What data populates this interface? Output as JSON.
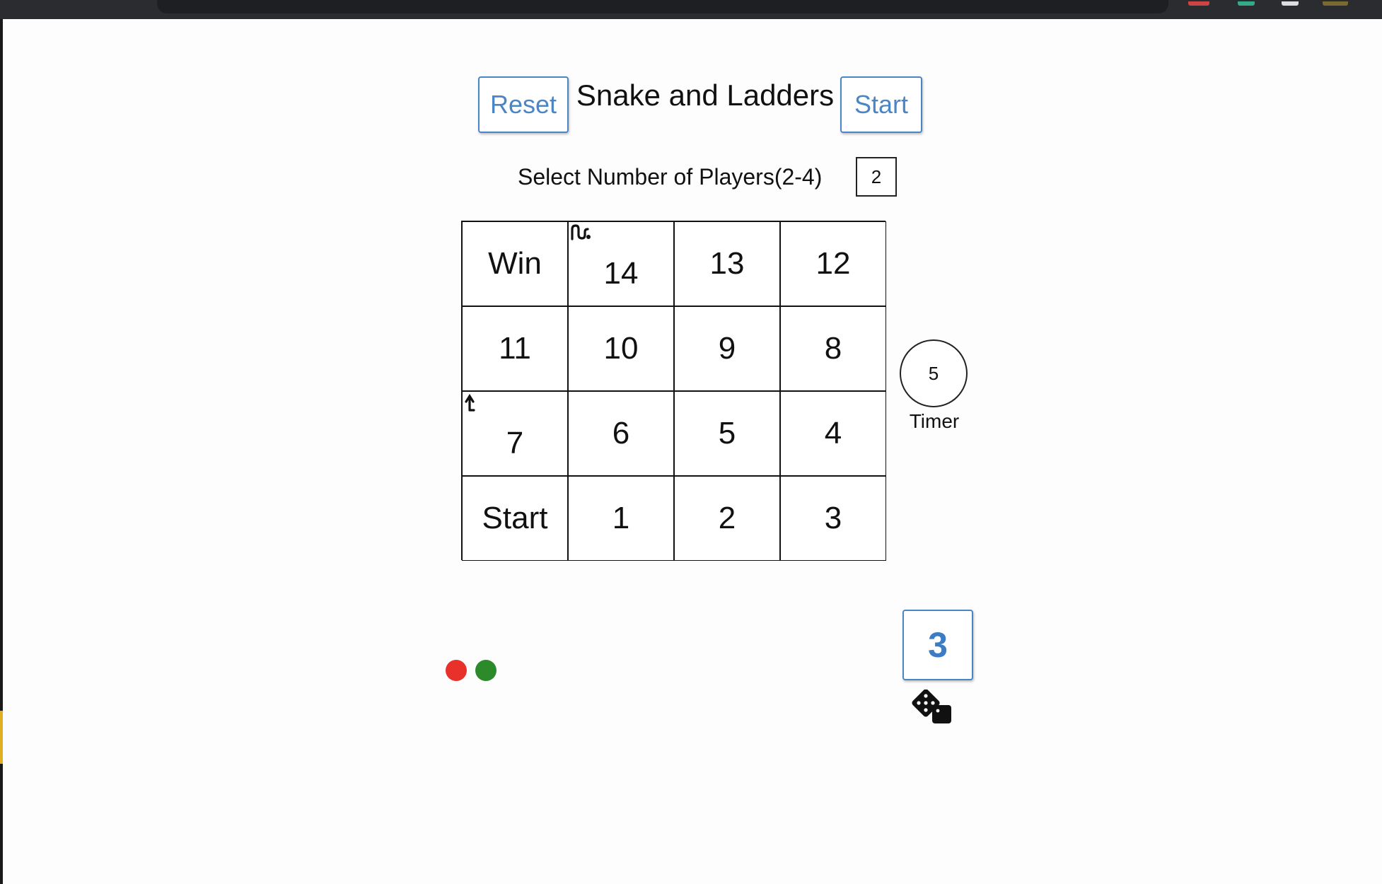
{
  "header": {
    "reset_label": "Reset",
    "title": "Snake and Ladders",
    "start_label": "Start"
  },
  "players": {
    "label": "Select Number of Players(2-4)",
    "value": "2"
  },
  "board": {
    "rows": [
      [
        {
          "label": "Win"
        },
        {
          "label": "14",
          "marker": "snake"
        },
        {
          "label": "13"
        },
        {
          "label": "12"
        }
      ],
      [
        {
          "label": "11"
        },
        {
          "label": "10"
        },
        {
          "label": "9"
        },
        {
          "label": "8"
        }
      ],
      [
        {
          "label": "7",
          "marker": "ladder"
        },
        {
          "label": "6"
        },
        {
          "label": "5"
        },
        {
          "label": "4"
        }
      ],
      [
        {
          "label": "Start"
        },
        {
          "label": "1"
        },
        {
          "label": "2"
        },
        {
          "label": "3"
        }
      ]
    ]
  },
  "timer": {
    "value": "5",
    "label": "Timer"
  },
  "tokens": [
    {
      "player": "red",
      "color": "#e8312a"
    },
    {
      "player": "green",
      "color": "#2d8a2a"
    }
  ],
  "dice": {
    "value": "3",
    "icon": "dice-icon"
  },
  "colors": {
    "accent": "#4a86c5",
    "border": "#111111"
  }
}
